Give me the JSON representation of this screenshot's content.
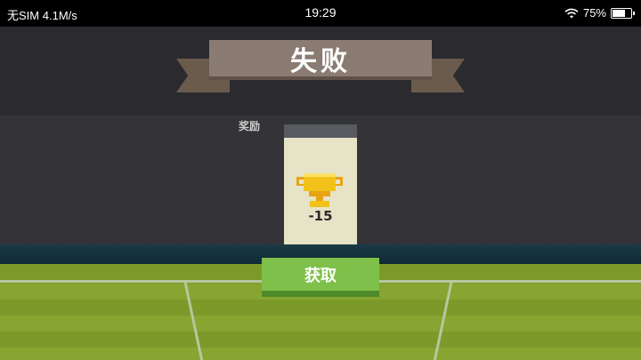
{
  "status_bar": {
    "carrier": "无SIM",
    "speed": "4.1M/s",
    "time": "19:29",
    "battery": "75%",
    "battery_level": 0.75,
    "icons": [
      "wifi-icon",
      "battery-icon"
    ]
  },
  "result": {
    "title": "失败"
  },
  "reward": {
    "label": "奖励",
    "icon": "trophy-icon",
    "value": "-15"
  },
  "actions": {
    "collect_label": "获取"
  },
  "colors": {
    "button": "#7fc04a",
    "ribbon": "#8a7c72",
    "card": "#e6e3c6",
    "trophy": "#f2c21b",
    "pitch": "#7c9a2a"
  }
}
